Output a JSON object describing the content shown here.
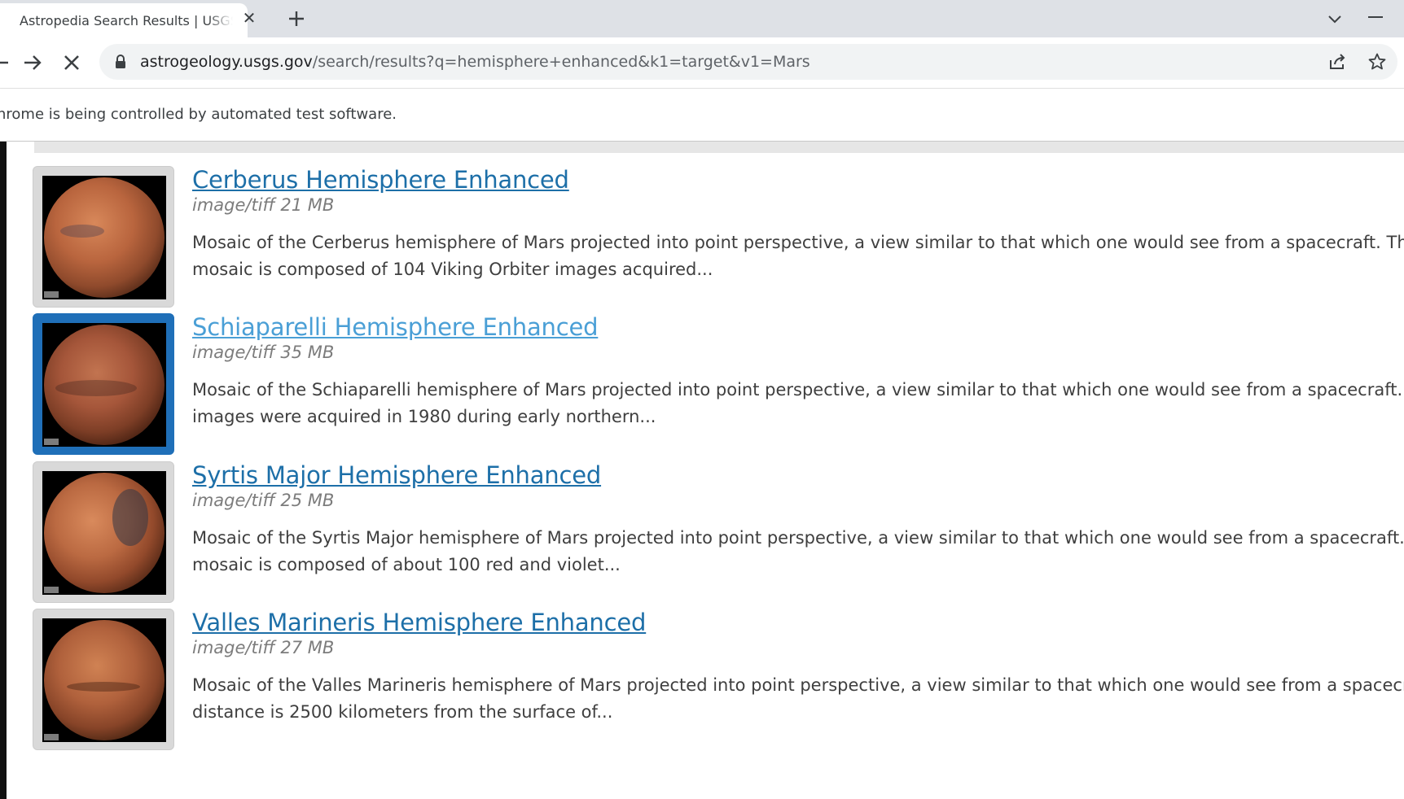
{
  "browser": {
    "tab_title": "Astropedia Search Results | USGS",
    "tab_close": "✕",
    "url_domain": "astrogeology.usgs.gov",
    "url_path": "/search/results?q=hemisphere+enhanced&k1=target&v1=Mars",
    "infobar_text": "hrome is being controlled by automated test software."
  },
  "results": [
    {
      "title": "Cerberus Hemisphere Enhanced",
      "meta": "image/tiff 21 MB",
      "desc_line1": "Mosaic of the Cerberus hemisphere of Mars projected into point perspective, a view similar to that which one would see from a spacecraft. This",
      "desc_line2": "mosaic is composed of 104 Viking Orbiter images acquired..."
    },
    {
      "title": "Schiaparelli Hemisphere Enhanced",
      "meta": "image/tiff 35 MB",
      "desc_line1": "Mosaic of the Schiaparelli hemisphere of Mars projected into point perspective, a view similar to that which one would see from a spacecraft. The",
      "desc_line2": "images were acquired in 1980 during early northern..."
    },
    {
      "title": "Syrtis Major Hemisphere Enhanced",
      "meta": "image/tiff 25 MB",
      "desc_line1": "Mosaic of the Syrtis Major hemisphere of Mars projected into point perspective, a view similar to that which one would see from a spacecraft. This",
      "desc_line2": "mosaic is composed of about 100 red and violet..."
    },
    {
      "title": "Valles Marineris Hemisphere Enhanced",
      "meta": "image/tiff 27 MB",
      "desc_line1": "Mosaic of the Valles Marineris hemisphere of Mars projected into point perspective, a view similar to that which one would see from a spacecraft. The",
      "desc_line2": "distance is 2500 kilometers from the surface of..."
    }
  ],
  "colors": {
    "link": "#1d6fa8",
    "link_hover": "#4a9fd6",
    "thumb_hover_border": "#1f6fb8"
  }
}
